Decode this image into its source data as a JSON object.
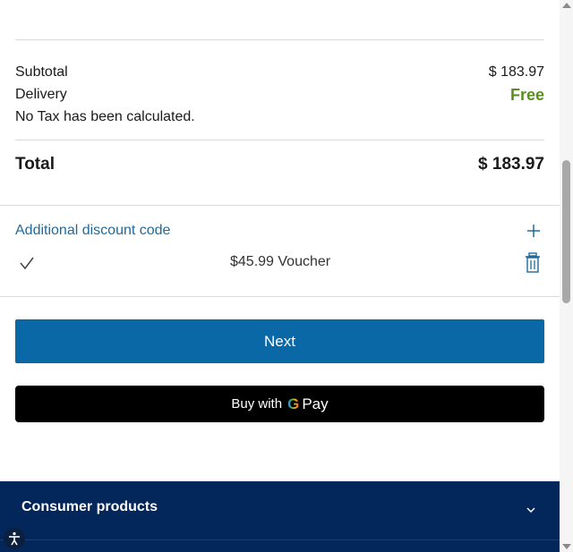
{
  "summary": {
    "subtotal_label": "Subtotal",
    "subtotal_value": "$ 183.97",
    "delivery_label": "Delivery",
    "delivery_value": "Free",
    "tax_note": "No Tax has been calculated."
  },
  "total": {
    "label": "Total",
    "value": "$ 183.97"
  },
  "discount": {
    "link_label": "Additional discount code",
    "add_icon": "plus-icon",
    "applied_voucher": "$45.99 Voucher",
    "check_icon": "check-icon",
    "remove_icon": "trash-icon"
  },
  "actions": {
    "next_label": "Next",
    "gpay_prefix": "Buy with",
    "gpay_brand_letter": "G",
    "gpay_brand_text": "Pay"
  },
  "footer": {
    "title": "Consumer products",
    "chevron_icon": "chevron-down-icon",
    "accessibility_icon": "accessibility-icon"
  },
  "colors": {
    "primary": "#0b68a7",
    "free": "#5a8f1f",
    "link": "#1f6a9a",
    "footer_bg": "#03275a"
  }
}
